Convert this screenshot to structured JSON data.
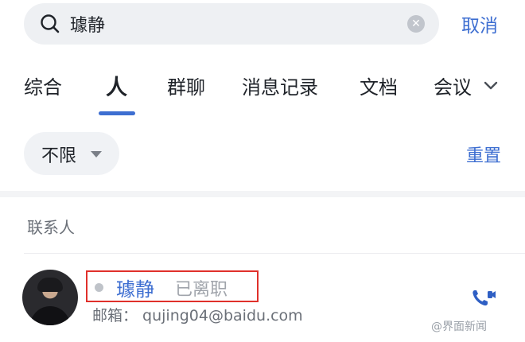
{
  "search": {
    "query": "璩静",
    "cancel_label": "取消"
  },
  "tabs": [
    {
      "label": "综合"
    },
    {
      "label": "人"
    },
    {
      "label": "群聊"
    },
    {
      "label": "消息记录"
    },
    {
      "label": "文档"
    },
    {
      "label": "会议"
    }
  ],
  "active_tab": "人",
  "filter": {
    "label": "不限",
    "reset_label": "重置"
  },
  "section": {
    "title": "联系人"
  },
  "contact": {
    "name": "璩静",
    "status": "已离职",
    "email_label": "邮箱：",
    "email": "qujing04@baidu.com",
    "email_line": "邮箱： qujing04@baidu.com"
  },
  "watermark": "@界面新闻",
  "colors": {
    "accent": "#3d6ed1",
    "highlight_border": "#e0302b",
    "search_bg": "#eef0f3"
  }
}
